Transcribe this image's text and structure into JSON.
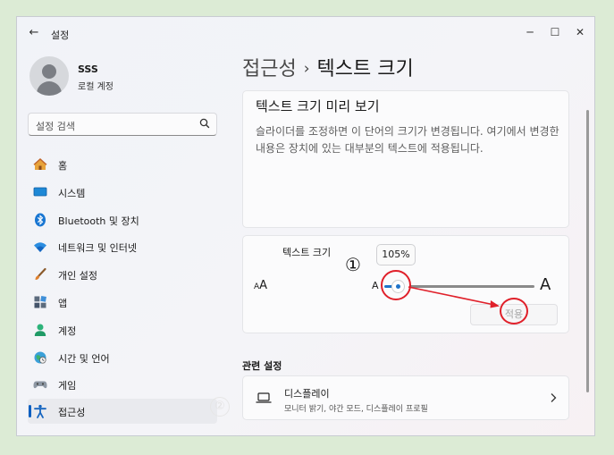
{
  "window": {
    "app_title": "설정",
    "back_symbol": "←",
    "minimize_symbol": "─",
    "maximize_symbol": "☐",
    "close_symbol": "✕"
  },
  "profile": {
    "name": "SSS",
    "account_type": "로컬 계정"
  },
  "search": {
    "placeholder": "설정 검색",
    "icon": "search-icon"
  },
  "sidebar": {
    "items": [
      {
        "label": "홈",
        "icon": "home-icon"
      },
      {
        "label": "시스템",
        "icon": "monitor-icon"
      },
      {
        "label": "Bluetooth 및 장치",
        "icon": "bluetooth-icon"
      },
      {
        "label": "네트워크 및 인터넷",
        "icon": "wifi-icon"
      },
      {
        "label": "개인 설정",
        "icon": "brush-icon"
      },
      {
        "label": "앱",
        "icon": "apps-icon"
      },
      {
        "label": "계정",
        "icon": "person-icon"
      },
      {
        "label": "시간 및 언어",
        "icon": "globe-clock-icon"
      },
      {
        "label": "게임",
        "icon": "gamepad-icon"
      },
      {
        "label": "접근성",
        "icon": "accessibility-icon",
        "active": true
      }
    ]
  },
  "breadcrumb": {
    "parent": "접근성",
    "separator": "›",
    "current": "텍스트 크기"
  },
  "preview": {
    "title": "텍스트 크기 미리 보기",
    "body": "슬라이더를 조정하면 이 단어의 크기가 변경됩니다. 여기에서 변경한 내용은 장치에 있는 대부분의 텍스트에 적용됩니다."
  },
  "text_size": {
    "label": "텍스트 크기",
    "icon_text_large": "A",
    "icon_text_small": "A",
    "value_tooltip": "105%",
    "slider_min_label": "A",
    "slider_max_label": "A",
    "slider_value_percent": 105,
    "apply_label": "적용"
  },
  "related": {
    "heading": "관련 설정",
    "display_title": "디스플레이",
    "display_sub": "모니터 밝기, 야간 모드, 디스플레이 프로필"
  },
  "annotations": {
    "step_one": "①",
    "step_two": "②"
  },
  "colors": {
    "accent": "#1f73c9",
    "annotation_red": "#e0202a",
    "nav_active_indicator": "#0a5fc1"
  }
}
